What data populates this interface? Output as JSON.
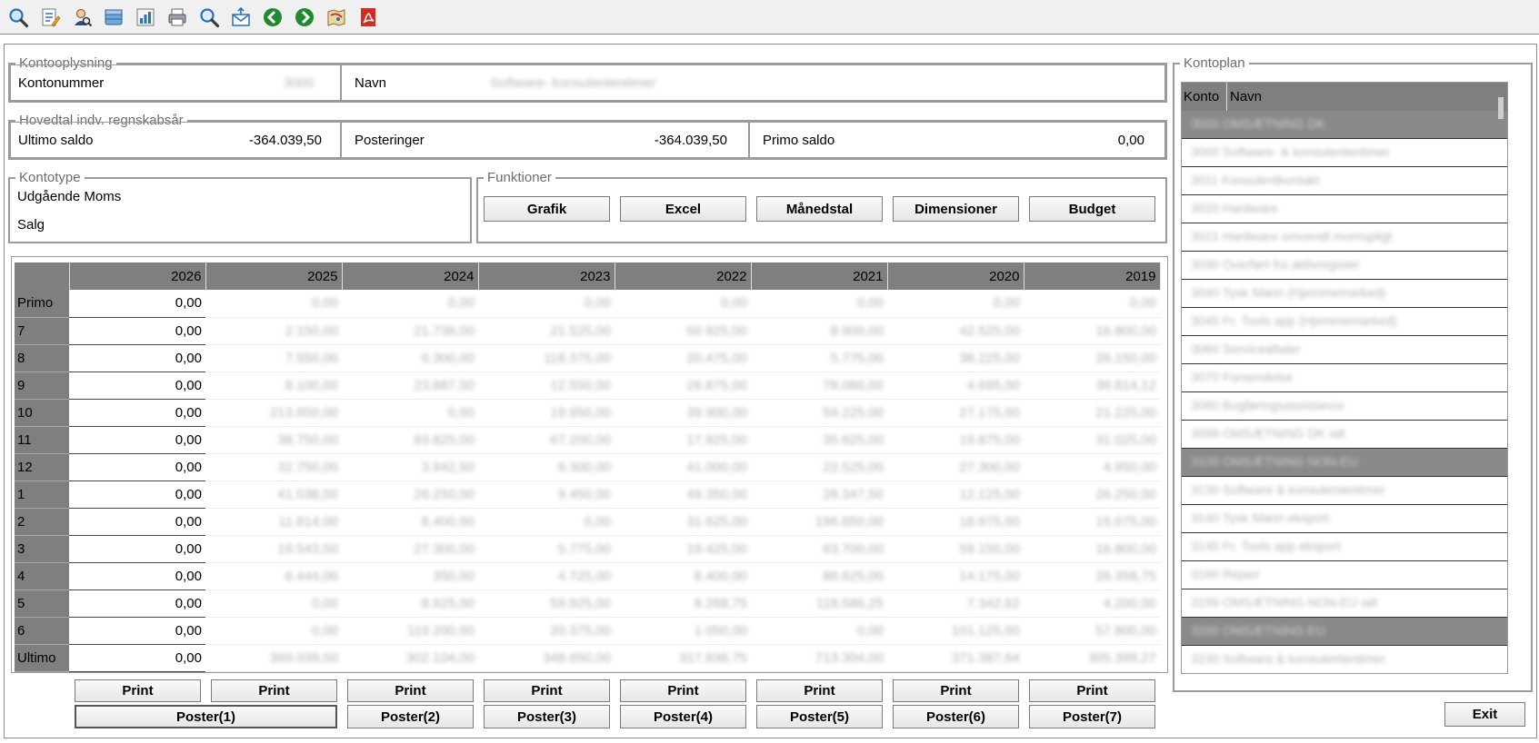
{
  "toolbar": {
    "icons": [
      "search-icon",
      "edit-document-icon",
      "user-search-icon",
      "database-icon",
      "report-icon",
      "print-icon",
      "zoom-icon",
      "email-icon",
      "back-arrow-icon",
      "forward-arrow-icon",
      "map-icon",
      "pdf-icon"
    ]
  },
  "kontooplysning": {
    "legend": "Kontooplysning",
    "kontonummer_label": "Kontonummer",
    "kontonummer_value": "3000",
    "navn_label": "Navn",
    "navn_value": "Software- konsulententimer"
  },
  "hovedtal": {
    "legend": "Hovedtal indv. regnskabsår",
    "ultimo_label": "Ultimo saldo",
    "ultimo_value": "-364.039,50",
    "posteringer_label": "Posteringer",
    "posteringer_value": "-364.039,50",
    "primo_label": "Primo saldo",
    "primo_value": "0,00"
  },
  "kontotype": {
    "legend": "Kontotype",
    "line1": "Udgående Moms",
    "line2": "Salg"
  },
  "funktioner": {
    "legend": "Funktioner",
    "buttons": [
      "Grafik",
      "Excel",
      "Månedstal",
      "Dimensioner",
      "Budget"
    ]
  },
  "grid": {
    "years": [
      "2026",
      "2025",
      "2024",
      "2023",
      "2022",
      "2021",
      "2020",
      "2019"
    ],
    "rows": [
      {
        "label": "Primo",
        "values": [
          "0,00",
          "0,00",
          "0,00",
          "0,00",
          "0,00",
          "0,00",
          "0,00",
          "0,00"
        ]
      },
      {
        "label": "7",
        "values": [
          "0,00",
          "2.150,00",
          "21.738,00",
          "21.525,00",
          "50.925,00",
          "8.900,00",
          "42.525,00",
          "16.800,00"
        ]
      },
      {
        "label": "8",
        "values": [
          "0,00",
          "7.550,00",
          "6.300,00",
          "118.375,00",
          "20.475,00",
          "5.775,00",
          "38.225,00",
          "26.150,00"
        ]
      },
      {
        "label": "9",
        "values": [
          "0,00",
          "8.100,00",
          "23.887,50",
          "12.550,00",
          "26.875,00",
          "78.066,00",
          "4.695,00",
          "39.814,12"
        ]
      },
      {
        "label": "10",
        "values": [
          "0,00",
          "213.650,00",
          "0,00",
          "19.950,00",
          "39.900,00",
          "59.225,00",
          "27.175,00",
          "21.225,00"
        ]
      },
      {
        "label": "11",
        "values": [
          "0,00",
          "38.750,00",
          "63.825,00",
          "67.200,00",
          "17.925,00",
          "35.625,00",
          "19.875,00",
          "31.025,00"
        ]
      },
      {
        "label": "12",
        "values": [
          "0,00",
          "32.750,00",
          "3.942,50",
          "6.300,00",
          "41.000,00",
          "22.525,00",
          "27.300,00",
          "4.950,00"
        ]
      },
      {
        "label": "1",
        "values": [
          "0,00",
          "41.538,00",
          "26.250,00",
          "9.450,00",
          "49.350,00",
          "28.347,50",
          "12.125,00",
          "26.250,00"
        ]
      },
      {
        "label": "2",
        "values": [
          "0,00",
          "11.814,00",
          "8.400,00",
          "0,00",
          "31.625,00",
          "196.850,00",
          "18.675,00",
          "15.075,00"
        ]
      },
      {
        "label": "3",
        "values": [
          "0,00",
          "19.543,50",
          "27.300,00",
          "5.775,00",
          "19.425,00",
          "63.700,00",
          "59.150,00",
          "16.800,00"
        ]
      },
      {
        "label": "4",
        "values": [
          "0,00",
          "6.444,00",
          "350,00",
          "4.725,00",
          "8.400,00",
          "86.625,00",
          "14.175,00",
          "26.358,75"
        ]
      },
      {
        "label": "5",
        "values": [
          "0,00",
          "0,00",
          "8.925,00",
          "59.925,00",
          "8.268,75",
          "118.586,25",
          "7.342,62",
          "4.200,00"
        ]
      },
      {
        "label": "6",
        "values": [
          "0,00",
          "0,00",
          "119.200,00",
          "20.375,00",
          "1.050,00",
          "0,00",
          "101.125,00",
          "57.800,00"
        ]
      },
      {
        "label": "Ultimo",
        "values": [
          "0,00",
          "369.039,50",
          "302.104,00",
          "348.650,00",
          "317.836,75",
          "713.304,00",
          "371.387,64",
          "305.399,27"
        ]
      }
    ],
    "print_label": "Print",
    "poster_labels": [
      "Poster(1)",
      "Poster(2)",
      "Poster(3)",
      "Poster(4)",
      "Poster(5)",
      "Poster(6)",
      "Poster(7)"
    ]
  },
  "kontoplan": {
    "legend": "Kontoplan",
    "col_konto": "Konto",
    "col_navn": "Navn",
    "rows": [
      {
        "text": "3000 OMSÆTNING DK",
        "group": true
      },
      {
        "text": "3000 Software- & konsulententimer",
        "group": false
      },
      {
        "text": "3011 Konsulentkontakt",
        "group": false
      },
      {
        "text": "3020 Hardware",
        "group": false
      },
      {
        "text": "3021 Hardware omvendt momspligt",
        "group": false
      },
      {
        "text": "3030 Overført fra aktivregister",
        "group": false
      },
      {
        "text": "3040 Tysk Marin (Hjemmemarked)",
        "group": false
      },
      {
        "text": "3045 Fr. Tools app (Hjemmemarked)",
        "group": false
      },
      {
        "text": "3060 Serviceaftaler",
        "group": false
      },
      {
        "text": "3070 Forsendelse",
        "group": false
      },
      {
        "text": "3080 Bogføringsassistance",
        "group": false
      },
      {
        "text": "3099 OMSÆTNING DK ialt",
        "group": false
      },
      {
        "text": "3100 OMSÆTNING NON-EU",
        "group": true
      },
      {
        "text": "3130 Software & konsulententimer",
        "group": false
      },
      {
        "text": "3140 Tysk Marin eksport",
        "group": false
      },
      {
        "text": "3145 Fr. Tools app eksport",
        "group": false
      },
      {
        "text": "3160 Rejser",
        "group": false
      },
      {
        "text": "3199 OMSÆTNING NON-EU ialt",
        "group": false
      },
      {
        "text": "3200 OMSÆTNING EU",
        "group": true
      },
      {
        "text": "3230 Software & konsulententimer",
        "group": false
      }
    ]
  },
  "exit_label": "Exit"
}
